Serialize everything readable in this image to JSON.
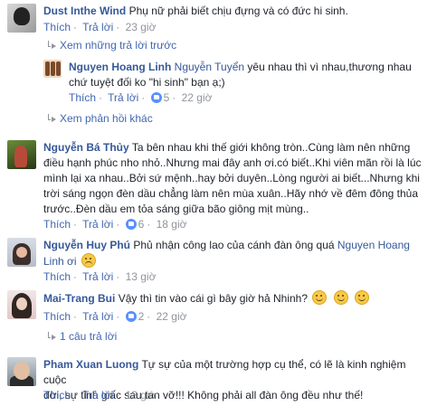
{
  "labels": {
    "like": "Thích",
    "reply": "Trả lời"
  },
  "colors": {
    "name": "#365899",
    "link": "#4267b2",
    "meta": "#90949c",
    "like_badge": "#5890ff"
  },
  "comments": [
    {
      "name": "Dust Inthe Wind",
      "text": "Phụ nữ phải biết chịu đựng và có đức hi sinh.",
      "time": "23 giờ",
      "avatar": "avatar-dust",
      "view_previous": "Xem những trả lời trước",
      "reply": {
        "name": "Nguyen Hoang Linh",
        "tag": "Nguyễn Tuyển",
        "text_line1": "yêu nhau thì vì nhau,thương nhau",
        "text_line2": "chứ tuyệt đối ko \"hi sinh\" bạn ạ;)",
        "likes": "5",
        "time": "22 giờ",
        "avatar": "avatar-linh-small"
      },
      "view_more": "Xem phản hồi khác"
    },
    {
      "name": "Nguyễn Bá Thủy",
      "line1": "Ta bên nhau khi thế giới không tròn..Cùng làm nên những",
      "line2": "điều hạnh phúc nho nhỏ..Nhưng mai đây anh ơi.có biết..Khi viên mãn rồi là lúc",
      "line3": "mình lại xa nhau..Bởi sứ mệnh..hay bởi duyên..Lòng người ai biết...Nhưng khi",
      "line4": "trời sáng ngọn đèn dầu chẳng làm nên mùa xuân..Hãy nhớ về đêm đông thủa",
      "line5": "trước..Đèn dầu em tỏa sáng giữa bão giông mịt mùng..",
      "likes": "6",
      "time": "18 giờ",
      "avatar": "avatar-thuy"
    },
    {
      "name": "Nguyễn Huy Phú",
      "text": "Phủ nhận công lao của cánh đàn ông quá",
      "tag": "Nguyen Hoang",
      "line2": "Linh ơi",
      "time": "13 giờ",
      "avatar": "avatar-phu"
    },
    {
      "name": "Mai-Trang Bui",
      "text": "Vậy thì tin vào cái gì bây giờ hả Nhinh?",
      "likes": "2",
      "time": "22 giờ",
      "replies_link": "1 câu trả lời",
      "avatar": "avatar-trang"
    },
    {
      "name": "Pham Xuan Luong",
      "text": "Tự sự của một trường hợp cụ thể, có lẽ là kinh nghiệm cuộc",
      "line2": "đời, sự tỉnh giấc sau tan vỡ!!! Không phải all đàn ông đều như thế!",
      "time": "13 giờ",
      "avatar": "avatar-luong"
    }
  ]
}
